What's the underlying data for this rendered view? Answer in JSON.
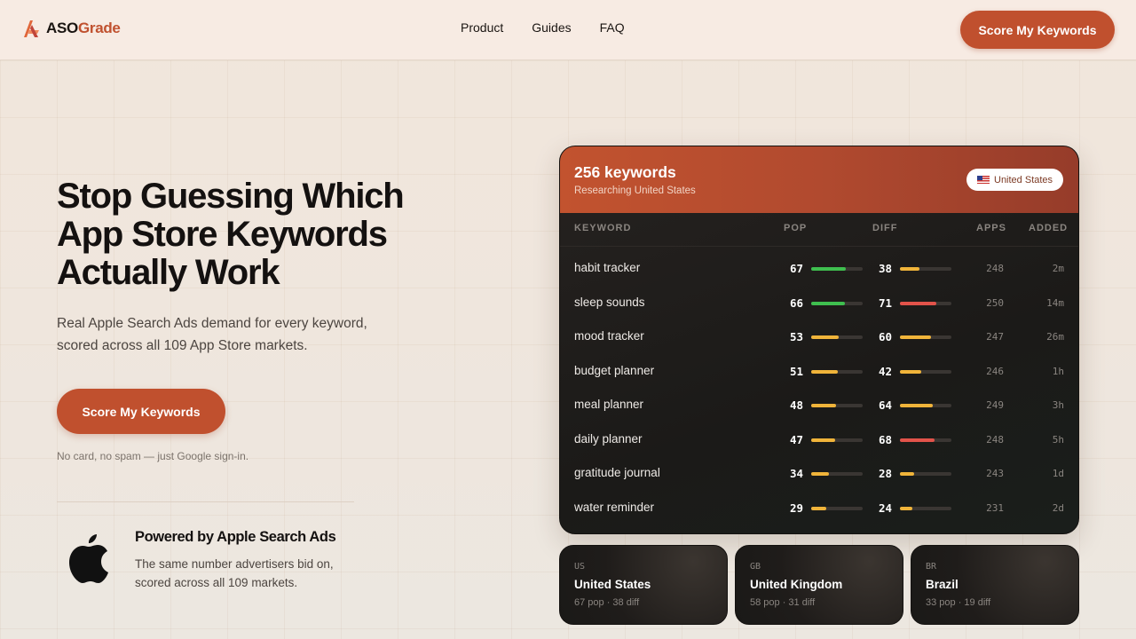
{
  "nav": {
    "logo_a": "ASO",
    "logo_b": "Grade",
    "links": [
      "Product",
      "Guides",
      "FAQ"
    ],
    "cta": "Score My Keywords"
  },
  "hero": {
    "title": "Stop Guessing Which App Store Keywords Actually Work",
    "subtitle": "Real Apple Search Ads demand for every keyword, scored across all 109 App Store markets.",
    "cta": "Score My Keywords",
    "note": "No card, no spam — just Google sign-in."
  },
  "powered": {
    "title": "Powered by Apple Search Ads",
    "subtitle": "The same number advertisers bid on, scored across all 109 markets."
  },
  "card": {
    "count": "256 keywords",
    "researching": "Researching United States",
    "country": "United States",
    "headers": {
      "keyword": "KEYWORD",
      "pop": "POP",
      "diff": "DIFF",
      "apps": "APPS",
      "added": "ADDED"
    },
    "rows": [
      {
        "keyword": "habit tracker",
        "pop": 67,
        "diff": 38,
        "apps": "248",
        "added": "2m"
      },
      {
        "keyword": "sleep sounds",
        "pop": 66,
        "diff": 71,
        "apps": "250",
        "added": "14m"
      },
      {
        "keyword": "mood tracker",
        "pop": 53,
        "diff": 60,
        "apps": "247",
        "added": "26m"
      },
      {
        "keyword": "budget planner",
        "pop": 51,
        "diff": 42,
        "apps": "246",
        "added": "1h"
      },
      {
        "keyword": "meal planner",
        "pop": 48,
        "diff": 64,
        "apps": "249",
        "added": "3h"
      },
      {
        "keyword": "daily planner",
        "pop": 47,
        "diff": 68,
        "apps": "248",
        "added": "5h"
      },
      {
        "keyword": "gratitude journal",
        "pop": 34,
        "diff": 28,
        "apps": "243",
        "added": "1d"
      },
      {
        "keyword": "water reminder",
        "pop": 29,
        "diff": 24,
        "apps": "231",
        "added": "2d"
      }
    ],
    "colors": {
      "green": "#3fbf4f",
      "yellow": "#f0b43a",
      "red": "#e2534a"
    }
  },
  "markets": [
    {
      "code": "US",
      "name": "United States",
      "stats": "67 pop · 38 diff"
    },
    {
      "code": "GB",
      "name": "United Kingdom",
      "stats": "58 pop · 31 diff"
    },
    {
      "code": "BR",
      "name": "Brazil",
      "stats": "33 pop · 19 diff"
    }
  ]
}
